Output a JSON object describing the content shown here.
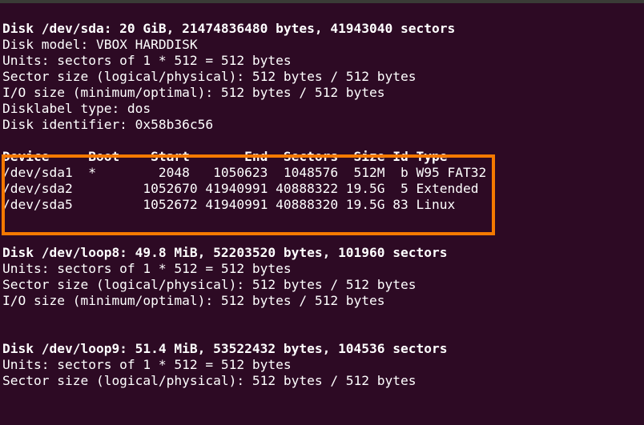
{
  "terminal": {
    "background_color": "#2d0a24",
    "foreground_color": "#ffffff",
    "highlight_color": "#f57900",
    "lines": [
      {
        "text": "Disk /dev/sda: 20 GiB, 21474836480 bytes, 41943040 sectors",
        "bold": true,
        "name": "line-sda-header"
      },
      {
        "text": "Disk model: VBOX HARDDISK",
        "bold": false,
        "name": "line-sda-model"
      },
      {
        "text": "Units: sectors of 1 * 512 = 512 bytes",
        "bold": false,
        "name": "line-sda-units"
      },
      {
        "text": "Sector size (logical/physical): 512 bytes / 512 bytes",
        "bold": false,
        "name": "line-sda-sector-size"
      },
      {
        "text": "I/O size (minimum/optimal): 512 bytes / 512 bytes",
        "bold": false,
        "name": "line-sda-io-size"
      },
      {
        "text": "Disklabel type: dos",
        "bold": false,
        "name": "line-sda-disklabel"
      },
      {
        "text": "Disk identifier: 0x58b36c56",
        "bold": false,
        "name": "line-sda-identifier"
      },
      {
        "text": "",
        "bold": false,
        "name": "line-blank-1"
      },
      {
        "text": "Device     Boot    Start       End  Sectors  Size Id Type",
        "bold": true,
        "name": "line-partition-table-header"
      },
      {
        "text": "/dev/sda1  *        2048   1050623  1048576  512M  b W95 FAT32",
        "bold": false,
        "name": "line-partition-sda1"
      },
      {
        "text": "/dev/sda2         1052670 41940991 40888322 19.5G  5 Extended",
        "bold": false,
        "name": "line-partition-sda2"
      },
      {
        "text": "/dev/sda5         1052672 41940991 40888320 19.5G 83 Linux",
        "bold": false,
        "name": "line-partition-sda5"
      },
      {
        "text": "",
        "bold": false,
        "name": "line-blank-2"
      },
      {
        "text": "",
        "bold": false,
        "name": "line-blank-3"
      },
      {
        "text": "Disk /dev/loop8: 49.8 MiB, 52203520 bytes, 101960 sectors",
        "bold": true,
        "name": "line-loop8-header"
      },
      {
        "text": "Units: sectors of 1 * 512 = 512 bytes",
        "bold": false,
        "name": "line-loop8-units"
      },
      {
        "text": "Sector size (logical/physical): 512 bytes / 512 bytes",
        "bold": false,
        "name": "line-loop8-sector-size"
      },
      {
        "text": "I/O size (minimum/optimal): 512 bytes / 512 bytes",
        "bold": false,
        "name": "line-loop8-io-size"
      },
      {
        "text": "",
        "bold": false,
        "name": "line-blank-4"
      },
      {
        "text": "",
        "bold": false,
        "name": "line-blank-5"
      },
      {
        "text": "Disk /dev/loop9: 51.4 MiB, 53522432 bytes, 104536 sectors",
        "bold": true,
        "name": "line-loop9-header"
      },
      {
        "text": "Units: sectors of 1 * 512 = 512 bytes",
        "bold": false,
        "name": "line-loop9-units"
      },
      {
        "text": "Sector size (logical/physical): 512 bytes / 512 bytes",
        "bold": false,
        "name": "line-loop9-sector-size"
      }
    ],
    "partition_table": {
      "columns": [
        "Device",
        "Boot",
        "Start",
        "End",
        "Sectors",
        "Size",
        "Id",
        "Type"
      ],
      "rows": [
        {
          "device": "/dev/sda1",
          "boot": "*",
          "start": "2048",
          "end": "1050623",
          "sectors": "1048576",
          "size": "512M",
          "id": "b",
          "type": "W95 FAT32"
        },
        {
          "device": "/dev/sda2",
          "boot": "",
          "start": "1052670",
          "end": "41940991",
          "sectors": "40888322",
          "size": "19.5G",
          "id": "5",
          "type": "Extended"
        },
        {
          "device": "/dev/sda5",
          "boot": "",
          "start": "1052672",
          "end": "41940991",
          "sectors": "40888320",
          "size": "19.5G",
          "id": "83",
          "type": "Linux"
        }
      ]
    },
    "disks": [
      {
        "name": "/dev/sda",
        "size_human": "20 GiB",
        "size_bytes": "21474836480",
        "sectors": "41943040",
        "model": "VBOX HARDDISK",
        "units": "sectors of 1 * 512 = 512 bytes",
        "sector_size": "512 bytes / 512 bytes",
        "io_size": "512 bytes / 512 bytes",
        "disklabel_type": "dos",
        "disk_identifier": "0x58b36c56"
      },
      {
        "name": "/dev/loop8",
        "size_human": "49.8 MiB",
        "size_bytes": "52203520",
        "sectors": "101960",
        "units": "sectors of 1 * 512 = 512 bytes",
        "sector_size": "512 bytes / 512 bytes",
        "io_size": "512 bytes / 512 bytes"
      },
      {
        "name": "/dev/loop9",
        "size_human": "51.4 MiB",
        "size_bytes": "53522432",
        "sectors": "104536",
        "units": "sectors of 1 * 512 = 512 bytes",
        "sector_size": "512 bytes / 512 bytes"
      }
    ]
  }
}
